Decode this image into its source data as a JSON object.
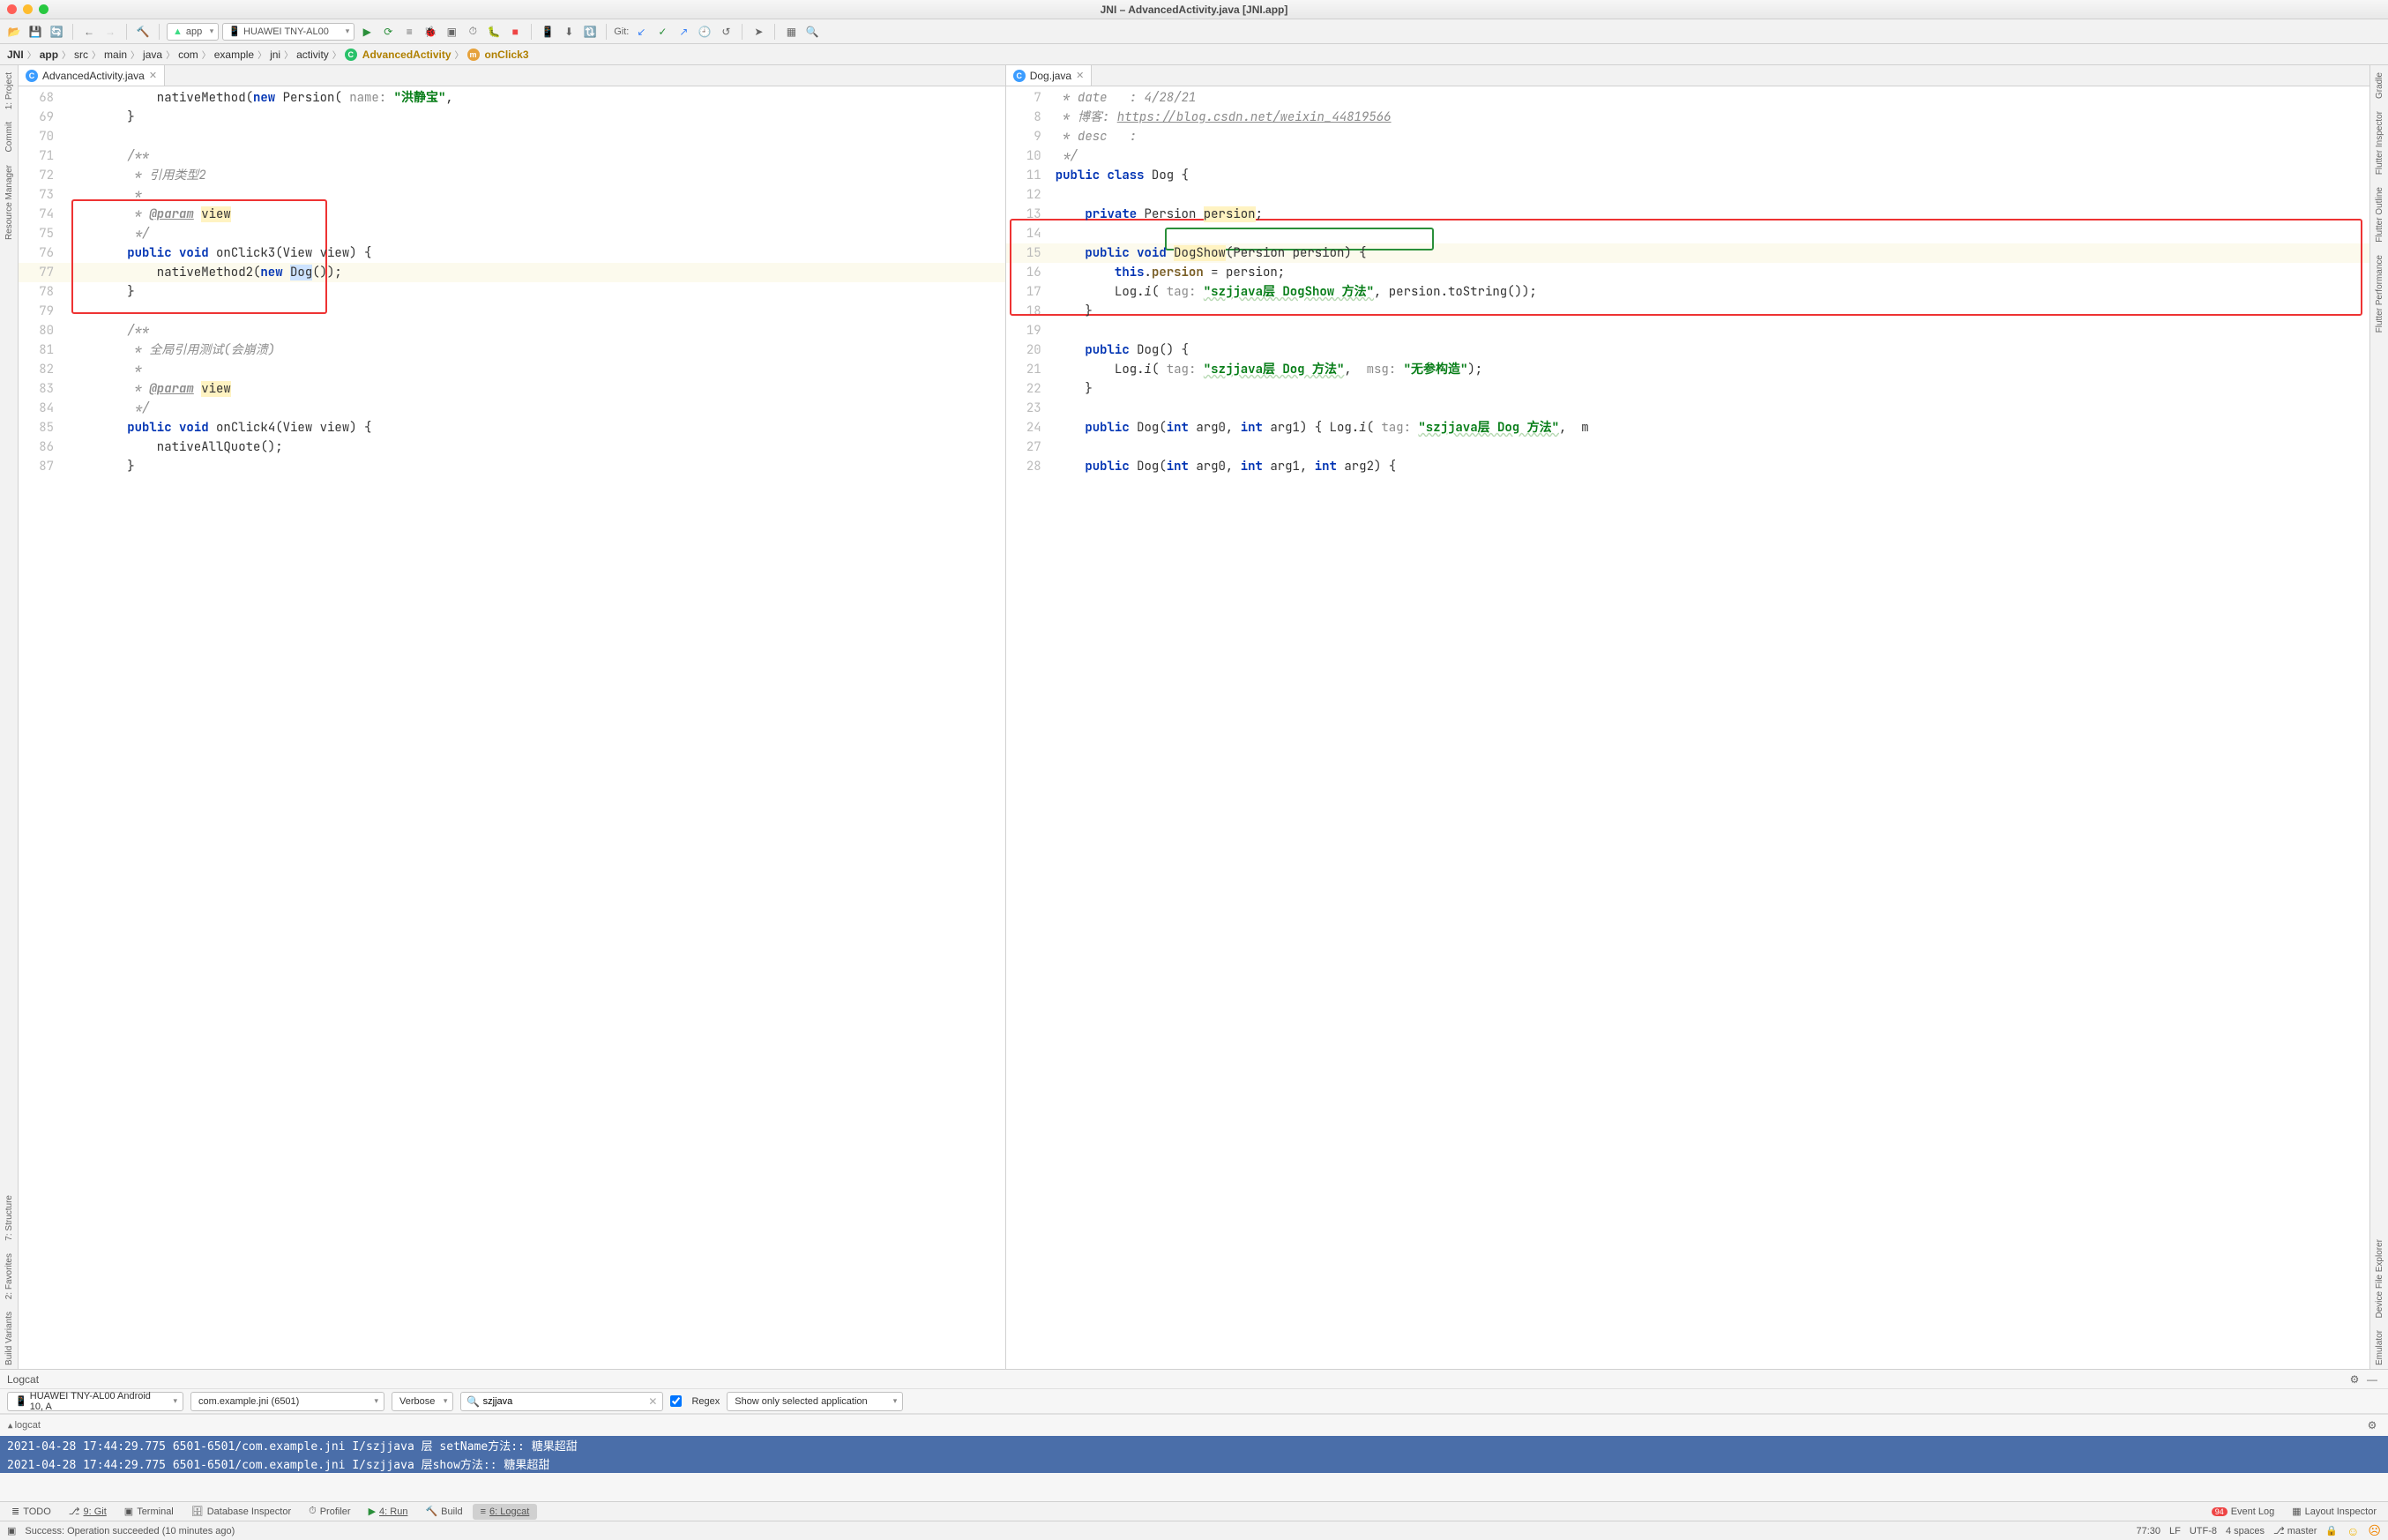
{
  "window": {
    "title": "JNI – AdvancedActivity.java [JNI.app]"
  },
  "toolbar": {
    "run_config": "app",
    "device": "HUAWEI TNY-AL00",
    "git_label": "Git:"
  },
  "breadcrumb": {
    "items": [
      "JNI",
      "app",
      "src",
      "main",
      "java",
      "com",
      "example",
      "jni",
      "activity"
    ],
    "class": "AdvancedActivity",
    "method": "onClick3"
  },
  "left_tabs": {
    "tab0": "AdvancedActivity.java"
  },
  "right_tabs": {
    "tab0": "Dog.java"
  },
  "left_code": {
    "lines": [
      "68",
      "69",
      "70",
      "71",
      "72",
      "73",
      "74",
      "75",
      "76",
      "77",
      "78",
      "79",
      "80",
      "81",
      "82",
      "83",
      "84",
      "85",
      "86",
      "87"
    ],
    "l68_a": "            nativeMethod(",
    "l68_new": "new",
    "l68_b": " Persion( ",
    "l68_name": "name:",
    "l68_c": " ",
    "l68_str": "\"洪静宝\"",
    "l68_d": ",",
    "l69": "        }",
    "l70": "",
    "l71": "        /**",
    "l72": "         * 引用类型2",
    "l73": "         *",
    "l74_a": "         * ",
    "l74_tag": "@param",
    "l74_sp": " ",
    "l74_v": "view",
    "l75": "         */",
    "l76_a": "        ",
    "l76_pub": "public",
    "l76_b": " ",
    "l76_void": "void",
    "l76_c": " onClick3(View view) {",
    "l77_a": "            nativeMethod2(",
    "l77_new": "new",
    "l77_b": " ",
    "l77_dog": "Dog",
    "l77_c": "());",
    "l78": "        }",
    "l79": "",
    "l80": "        /**",
    "l81": "         * 全局引用测试(会崩溃)",
    "l82": "         *",
    "l83_a": "         * ",
    "l83_tag": "@param",
    "l83_sp": " ",
    "l83_v": "view",
    "l84": "         */",
    "l85_a": "        ",
    "l85_pub": "public",
    "l85_b": " ",
    "l85_void": "void",
    "l85_c": " onClick4(View view) {",
    "l86": "            nativeAllQuote();",
    "l87": "        }"
  },
  "right_code": {
    "lines": [
      "7",
      "8",
      "9",
      "10",
      "11",
      "12",
      "13",
      "14",
      "15",
      "16",
      "17",
      "18",
      "19",
      "20",
      "21",
      "22",
      "23",
      "24",
      "27",
      "28"
    ],
    "l7_a": " * date   : ",
    "l7_b": "4/28/21",
    "l8_a": " * 博客: ",
    "l8_b": "https://blog.csdn.net/weixin_44819566",
    "l9": " * desc   :",
    "l10": " */",
    "l11_a": "public",
    "l11_b": " ",
    "l11_c": "class",
    "l11_d": " Dog {",
    "l13_a": "    ",
    "l13_b": "private",
    "l13_c": " Persion ",
    "l13_d": "persion",
    "l13_e": ";",
    "l15_a": "    ",
    "l15_b": "public",
    "l15_c": " ",
    "l15_d": "void",
    "l15_e": " ",
    "l15_f": "DogShow",
    "l15_g": "(Persion persion) {",
    "l16_a": "        ",
    "l16_b": "this",
    "l16_c": ".",
    "l16_d": "persion",
    "l16_e": " = persion;",
    "l17_a": "        Log.",
    "l17_b": "i",
    "l17_c": "( ",
    "l17_tag": "tag:",
    "l17_d": " ",
    "l17_str": "\"szjjava层 DogShow 方法\"",
    "l17_e": ", persion.toString());",
    "l18": "    }",
    "l20_a": "    ",
    "l20_b": "public",
    "l20_c": " Dog() {",
    "l21_a": "        Log.",
    "l21_b": "i",
    "l21_c": "( ",
    "l21_tag": "tag:",
    "l21_d": " ",
    "l21_str": "\"szjjava层 Dog 方法\"",
    "l21_e": ",  ",
    "l21_msg": "msg:",
    "l21_f": " ",
    "l21_str2": "\"无参构造\"",
    "l21_g": ");",
    "l22": "    }",
    "l24_a": "    ",
    "l24_b": "public",
    "l24_c": " Dog(",
    "l24_d": "int",
    "l24_e": " arg0, ",
    "l24_f": "int",
    "l24_g": " arg1) { Log.",
    "l24_h": "i",
    "l24_i": "( ",
    "l24_tag": "tag:",
    "l24_j": " ",
    "l24_str": "\"szjjava层 Dog 方法\"",
    "l24_k": ",  m",
    "l28_a": "    ",
    "l28_b": "public",
    "l28_c": " Dog(",
    "l28_d": "int",
    "l28_e": " arg0, ",
    "l28_f": "int",
    "l28_g": " arg1, ",
    "l28_h": "int",
    "l28_i": " arg2) {"
  },
  "rail_left": {
    "project": "1: Project",
    "resmgr": "Resource Manager",
    "commit": "Commit",
    "structure": "7: Structure",
    "fav": "2: Favorites",
    "bv": "Build Variants"
  },
  "rail_right": {
    "gradle": "Gradle",
    "flutins": "Flutter Inspector",
    "flout": "Flutter Outline",
    "fluperf": "Flutter Performance",
    "devexp": "Device File Explorer",
    "emu": "Emulator"
  },
  "logcat": {
    "title": "Logcat",
    "sub": "logcat",
    "device": "HUAWEI TNY-AL00 Android 10, A",
    "process": "com.example.jni (6501)",
    "level": "Verbose",
    "filter": "szjjava",
    "regex": "Regex",
    "only": "Show only selected application",
    "line1": "2021-04-28 17:44:29.775 6501-6501/com.example.jni I/szjjava 层 setName方法:: 糖果超甜",
    "line2": "2021-04-28 17:44:29.775 6501-6501/com.example.jni I/szjjava 层show方法:: 糖果超甜"
  },
  "bottom": {
    "todo": "TODO",
    "git": "9: Git",
    "term": "Terminal",
    "db": "Database Inspector",
    "prof": "Profiler",
    "run": "4: Run",
    "build": "Build",
    "log": "6: Logcat",
    "evlog": "Event Log",
    "layout": "Layout Inspector",
    "evbadge": "94"
  },
  "status": {
    "msg": "Success: Operation succeeded (10 minutes ago)",
    "pos": "77:30",
    "lf": "LF",
    "enc": "UTF-8",
    "sp": "4 spaces",
    "branch": "master"
  }
}
